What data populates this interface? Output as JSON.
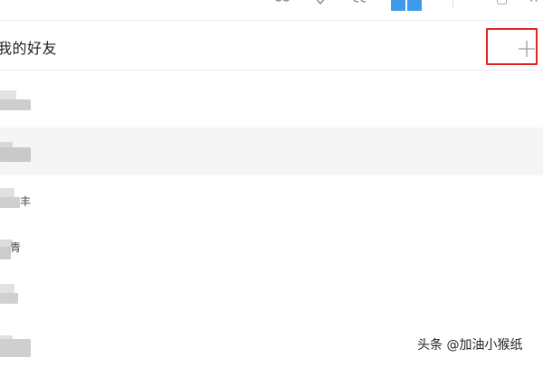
{
  "header": {
    "title": "我的好友",
    "add_icon": "plus-icon"
  },
  "toolbar_icons": [
    "transfer-icon",
    "headset-icon",
    "video-call-icon",
    "folder-icon"
  ],
  "friend_rows": [
    {
      "name": "",
      "selected": false
    },
    {
      "name": "",
      "selected": true
    },
    {
      "name": "丰",
      "selected": false
    },
    {
      "name": "青",
      "selected": false
    },
    {
      "name": "",
      "selected": false
    },
    {
      "name": "",
      "selected": false
    }
  ],
  "watermark": "头条 @加油小猴纸",
  "colors": {
    "highlight_box": "#e02424",
    "selected_row": "#f5f5f5",
    "accent_blue": "#3d9bea"
  }
}
